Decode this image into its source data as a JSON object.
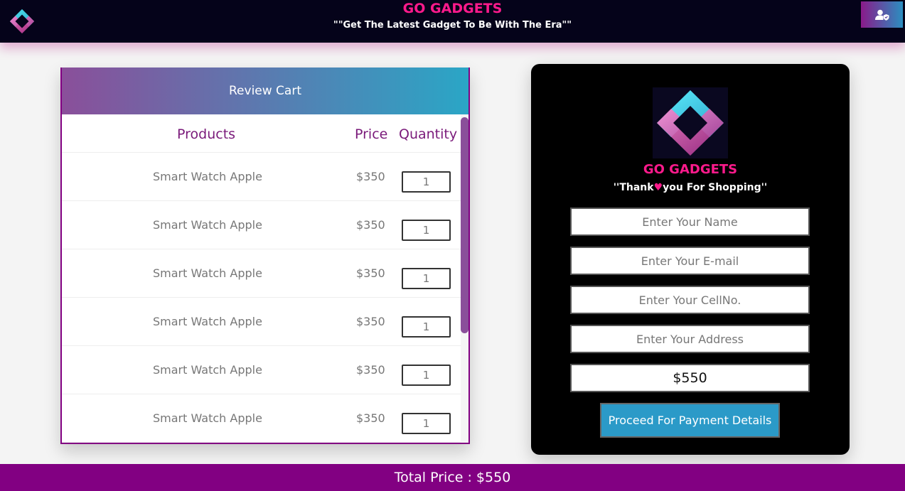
{
  "header": {
    "brand": "GO GADGETS",
    "tagline": "\"\"Get The Latest Gadget To Be With The Era\"\""
  },
  "cart": {
    "title": "Review Cart",
    "columns": {
      "product": "Products",
      "price": "Price",
      "quantity": "Quantity"
    },
    "items": [
      {
        "name": "Smart Watch Apple",
        "price": "$350",
        "qty": "1"
      },
      {
        "name": "Smart Watch Apple",
        "price": "$350",
        "qty": "1"
      },
      {
        "name": "Smart Watch Apple",
        "price": "$350",
        "qty": "1"
      },
      {
        "name": "Smart Watch Apple",
        "price": "$350",
        "qty": "1"
      },
      {
        "name": "Smart Watch Apple",
        "price": "$350",
        "qty": "1"
      },
      {
        "name": "Smart Watch Apple",
        "price": "$350",
        "qty": "1"
      }
    ]
  },
  "checkout": {
    "brand": "GO GADGETS",
    "thanks_left": "''Thank",
    "thanks_right": "you For Shopping''",
    "fields": {
      "name": "Enter Your Name",
      "email": "Enter Your E-mail",
      "cell": "Enter Your CellNo.",
      "address": "Enter Your Address"
    },
    "total": "$550",
    "proceed_label": "Proceed For Payment Details"
  },
  "footer": {
    "total_text": "Total Price : $550"
  },
  "colors": {
    "brand_pink": "#ff1a8c",
    "purple": "#820082",
    "header_bg": "#05031a",
    "button_blue": "#2b9ac8"
  },
  "icons": [
    "brand-logo-icon",
    "user-shield-icon",
    "heart-icon"
  ]
}
